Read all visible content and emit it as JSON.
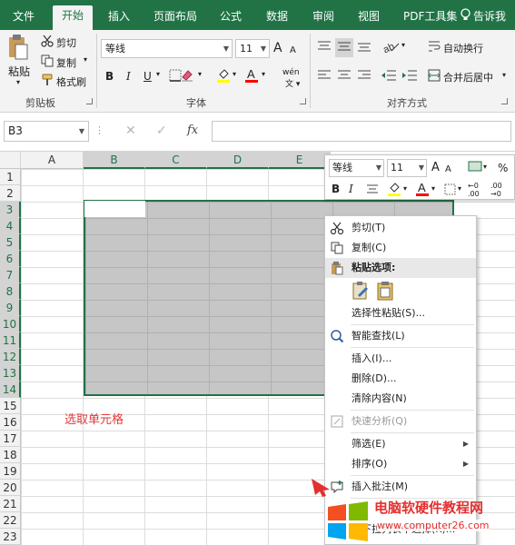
{
  "tabs": [
    {
      "label": "文件",
      "active": false
    },
    {
      "label": "开始",
      "active": true
    },
    {
      "label": "插入",
      "active": false
    },
    {
      "label": "页面布局",
      "active": false
    },
    {
      "label": "公式",
      "active": false
    },
    {
      "label": "数据",
      "active": false
    },
    {
      "label": "审阅",
      "active": false
    },
    {
      "label": "视图",
      "active": false
    },
    {
      "label": "PDF工具集",
      "active": false
    }
  ],
  "tell_me": "告诉我",
  "ribbon": {
    "clipboard": {
      "paste": "粘贴",
      "cut": "剪切",
      "copy": "复制",
      "format_painter": "格式刷",
      "label": "剪贴板"
    },
    "font": {
      "name": "等线",
      "size": "11",
      "bold": "B",
      "italic": "I",
      "underline": "U",
      "label": "字体",
      "phonetic": "wén",
      "grow": "A",
      "shrink": "A",
      "fill_color": "#ffff00",
      "font_color": "#ff0000"
    },
    "alignment": {
      "wrap_text": "自动换行",
      "merge_center": "合并后居中",
      "label": "对齐方式"
    }
  },
  "formula_bar": {
    "name_box": "B3",
    "fx": "fx",
    "value": ""
  },
  "grid": {
    "columns": [
      "A",
      "B",
      "C",
      "D",
      "E"
    ],
    "rows": [
      "1",
      "2",
      "3",
      "4",
      "5",
      "6",
      "7",
      "8",
      "9",
      "10",
      "11",
      "12",
      "13",
      "14",
      "15",
      "16",
      "17",
      "18",
      "19",
      "20",
      "21",
      "22",
      "23"
    ],
    "annotation": "选取单元格",
    "accent": "#217346"
  },
  "mini_toolbar": {
    "font": "等线",
    "size": "11",
    "bold": "B",
    "italic": "I",
    "percent": "%"
  },
  "context_menu": {
    "cut": "剪切(T)",
    "copy": "复制(C)",
    "paste_options": "粘贴选项:",
    "paste_special": "选择性粘贴(S)...",
    "smart_lookup": "智能查找(L)",
    "insert": "插入(I)...",
    "delete": "删除(D)...",
    "clear": "清除内容(N)",
    "quick_analysis": "快速分析(Q)",
    "filter": "筛选(E)",
    "sort": "排序(O)",
    "insert_comment": "插入批注(M)",
    "format_cells": "单",
    "pick_list": "从下拉列表中选择(K)..."
  },
  "watermark": {
    "text": "电脑软硬件教程网",
    "url": "www.computer26.com"
  }
}
